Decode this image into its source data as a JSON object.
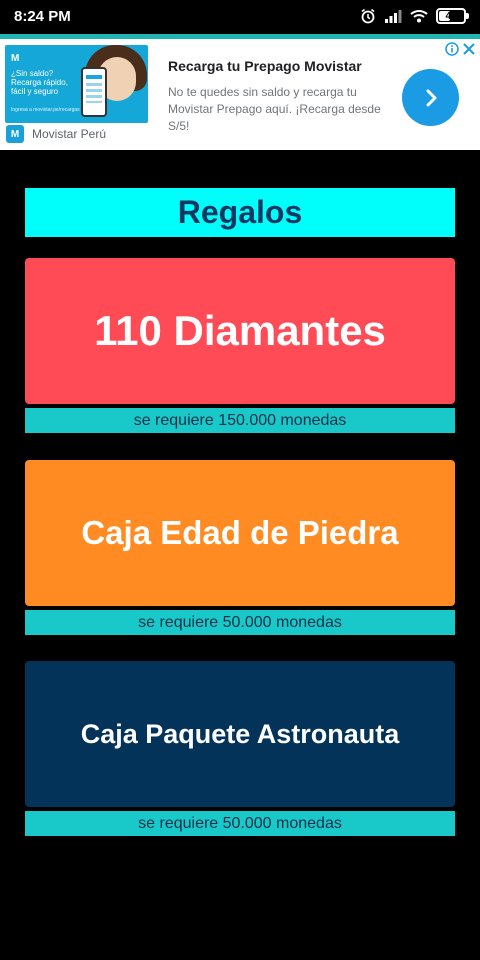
{
  "status_bar": {
    "time": "8:24 PM",
    "battery": "42",
    "battery_level": 0.42,
    "icons": [
      "alarm-icon",
      "signal-icon",
      "wifi-icon",
      "battery-icon"
    ]
  },
  "ad": {
    "image_logo": "M",
    "image_text": "¿Sin saldo? Recarga rápido, fácil y seguro",
    "image_small_text": "Ingresa a movistar.pe/recargas",
    "title": "Recarga tu Prepago Movistar",
    "description": "No te quedes sin saldo y recarga tu Movistar Prepago aquí. ¡Recarga desde S/5!",
    "source_logo": "M",
    "advertiser": "Movistar Perú",
    "icons": [
      "adchoices-info-icon",
      "close-icon",
      "chevron-right-icon"
    ]
  },
  "page": {
    "title": "Regalos"
  },
  "gifts": [
    {
      "name": "110 Diamantes",
      "requirement": "se requiere 150.000 monedas",
      "color": "#ff4b56"
    },
    {
      "name": "Caja Edad de Piedra",
      "requirement": "se requiere 50.000 monedas",
      "color": "#ff8b22"
    },
    {
      "name": "Caja Paquete Astronauta",
      "requirement": "se requiere 50.000 monedas",
      "color": "#033359"
    }
  ],
  "colors": {
    "background": "#000000",
    "header_bg": "#00fffb",
    "header_text": "#0a3a64",
    "requirement_bg": "#19c8c8",
    "requirement_text": "#11314a",
    "ad_cta": "#1a9be3"
  }
}
